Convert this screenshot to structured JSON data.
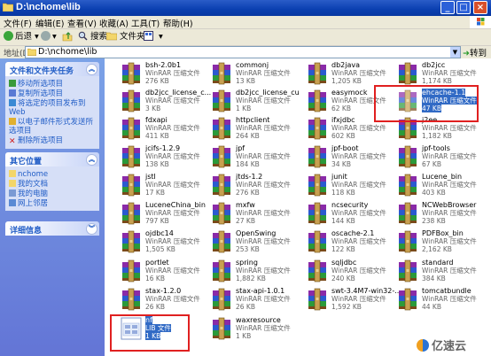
{
  "window": {
    "title": "D:\\nchome\\lib"
  },
  "menu": [
    "文件(F)",
    "编辑(E)",
    "查看(V)",
    "收藏(A)",
    "工具(T)",
    "帮助(H)"
  ],
  "toolbar": {
    "back": "后退",
    "search": "搜索",
    "folders": "文件夹"
  },
  "address": {
    "label": "地址(D)",
    "path": "D:\\nchome\\lib",
    "go": "转到"
  },
  "tasks": {
    "title": "文件和文件夹任务",
    "items": [
      "移动所选项目",
      "复制所选项目",
      "将选定的项目发布到 Web",
      "以电子邮件形式发送所选项目",
      "删除所选项目"
    ]
  },
  "places": {
    "title": "其它位置",
    "items": [
      "nchome",
      "我的文档",
      "我的电脑",
      "网上邻居"
    ]
  },
  "details": {
    "title": "详细信息"
  },
  "files": [
    {
      "name": "bsh-2.0b1",
      "type": "WinRAR 压缩文件",
      "size": "276 KB",
      "kind": "rar"
    },
    {
      "name": "commonj",
      "type": "WinRAR 压缩文件",
      "size": "13 KB",
      "kind": "rar"
    },
    {
      "name": "db2java",
      "type": "WinRAR 压缩文件",
      "size": "1,205 KB",
      "kind": "rar"
    },
    {
      "name": "db2jcc",
      "type": "WinRAR 压缩文件",
      "size": "1,174 KB",
      "kind": "rar"
    },
    {
      "name": "db2jcc_license_c...",
      "type": "WinRAR 压缩文件",
      "size": "3 KB",
      "kind": "rar"
    },
    {
      "name": "db2jcc_license_cu",
      "type": "WinRAR 压缩文件",
      "size": "1 KB",
      "kind": "rar"
    },
    {
      "name": "easymock",
      "type": "WinRAR 压缩文件",
      "size": "62 KB",
      "kind": "rar"
    },
    {
      "name": "ehcache-1.1",
      "type": "WinRAR 压缩文件",
      "size": "47 KB",
      "kind": "rar",
      "selected": true
    },
    {
      "name": "fdxapi",
      "type": "WinRAR 压缩文件",
      "size": "411 KB",
      "kind": "rar"
    },
    {
      "name": "httpclient",
      "type": "WinRAR 压缩文件",
      "size": "264 KB",
      "kind": "rar"
    },
    {
      "name": "ifxjdbc",
      "type": "WinRAR 压缩文件",
      "size": "602 KB",
      "kind": "rar"
    },
    {
      "name": "j2ee",
      "type": "WinRAR 压缩文件",
      "size": "1,182 KB",
      "kind": "rar"
    },
    {
      "name": "jcifs-1.2.9",
      "type": "WinRAR 压缩文件",
      "size": "138 KB",
      "kind": "rar"
    },
    {
      "name": "jpf",
      "type": "WinRAR 压缩文件",
      "size": "184 KB",
      "kind": "rar"
    },
    {
      "name": "jpf-boot",
      "type": "WinRAR 压缩文件",
      "size": "34 KB",
      "kind": "rar"
    },
    {
      "name": "jpf-tools",
      "type": "WinRAR 压缩文件",
      "size": "67 KB",
      "kind": "rar"
    },
    {
      "name": "jstl",
      "type": "WinRAR 压缩文件",
      "size": "17 KB",
      "kind": "rar"
    },
    {
      "name": "jtds-1.2",
      "type": "WinRAR 压缩文件",
      "size": "276 KB",
      "kind": "rar"
    },
    {
      "name": "junit",
      "type": "WinRAR 压缩文件",
      "size": "118 KB",
      "kind": "rar"
    },
    {
      "name": "Lucene_bin",
      "type": "WinRAR 压缩文件",
      "size": "403 KB",
      "kind": "rar"
    },
    {
      "name": "LuceneChina_bin",
      "type": "WinRAR 压缩文件",
      "size": "797 KB",
      "kind": "rar"
    },
    {
      "name": "mxfw",
      "type": "WinRAR 压缩文件",
      "size": "27 KB",
      "kind": "rar"
    },
    {
      "name": "ncsecurity",
      "type": "WinRAR 压缩文件",
      "size": "144 KB",
      "kind": "rar"
    },
    {
      "name": "NCWebBrowser",
      "type": "WinRAR 压缩文件",
      "size": "238 KB",
      "kind": "rar"
    },
    {
      "name": "ojdbc14",
      "type": "WinRAR 压缩文件",
      "size": "1,505 KB",
      "kind": "rar"
    },
    {
      "name": "OpenSwing",
      "type": "WinRAR 压缩文件",
      "size": "253 KB",
      "kind": "rar"
    },
    {
      "name": "oscache-2.1",
      "type": "WinRAR 压缩文件",
      "size": "122 KB",
      "kind": "rar"
    },
    {
      "name": "PDFBox_bin",
      "type": "WinRAR 压缩文件",
      "size": "2,162 KB",
      "kind": "rar"
    },
    {
      "name": "portlet",
      "type": "WinRAR 压缩文件",
      "size": "16 KB",
      "kind": "rar"
    },
    {
      "name": "spring",
      "type": "WinRAR 压缩文件",
      "size": "1,882 KB",
      "kind": "rar"
    },
    {
      "name": "sqljdbc",
      "type": "WinRAR 压缩文件",
      "size": "240 KB",
      "kind": "rar"
    },
    {
      "name": "standard",
      "type": "WinRAR 压缩文件",
      "size": "384 KB",
      "kind": "rar"
    },
    {
      "name": "stax-1.2.0",
      "type": "WinRAR 压缩文件",
      "size": "26 KB",
      "kind": "rar"
    },
    {
      "name": "stax-api-1.0.1",
      "type": "WinRAR 压缩文件",
      "size": "26 KB",
      "kind": "rar"
    },
    {
      "name": "swt-3.4M7-win32-...",
      "type": "WinRAR 压缩文件",
      "size": "1,592 KB",
      "kind": "rar"
    },
    {
      "name": "tomcatbundle",
      "type": "WinRAR 压缩文件",
      "size": "44 KB",
      "kind": "rar"
    },
    {
      "name": "nf",
      "type": "LIB 文件",
      "size": "1 KB",
      "kind": "lib",
      "selected": true
    },
    {
      "name": "waxresource",
      "type": "WinRAR 压缩文件",
      "size": "1 KB",
      "kind": "rar"
    }
  ],
  "watermark": "亿速云",
  "colors": {
    "titlebar": "#0a3fb0",
    "selection": "#316ac5",
    "highlight": "#e02020",
    "sidebar": "#6375d6"
  }
}
